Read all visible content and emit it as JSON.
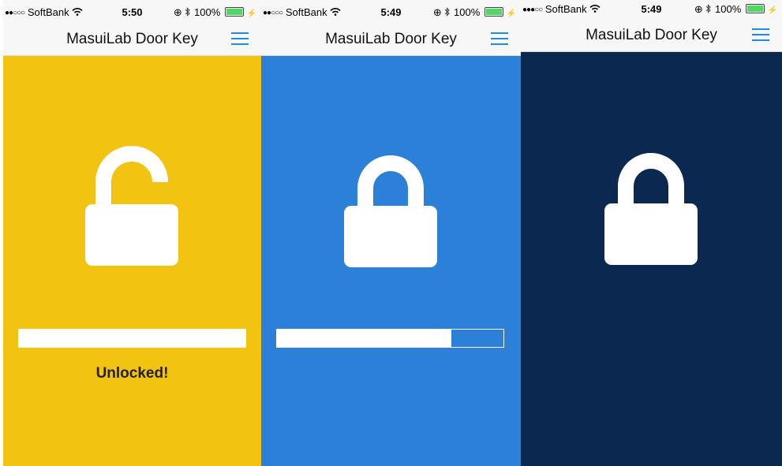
{
  "app_title": "MasuiLab Door Key",
  "screens": [
    {
      "status": {
        "carrier": "SoftBank",
        "time": "5:50",
        "battery": "100%"
      },
      "state": "unlocked",
      "background": "#f2c311",
      "progress": 1.0,
      "message": "Unlocked!"
    },
    {
      "status": {
        "carrier": "SoftBank",
        "time": "5:49",
        "battery": "100%"
      },
      "state": "locking",
      "background": "#2d80d7",
      "progress": 0.77
    },
    {
      "status": {
        "carrier": "SoftBank",
        "time": "5:49",
        "battery": "100%"
      },
      "state": "locked",
      "background": "#0a2850"
    }
  ],
  "icons": {
    "menu": "hamburger-menu-icon",
    "unlocked": "unlocked-padlock-icon",
    "locked": "locked-padlock-icon",
    "wifi": "wifi-icon",
    "bluetooth": "bluetooth-icon",
    "battery": "battery-icon"
  }
}
